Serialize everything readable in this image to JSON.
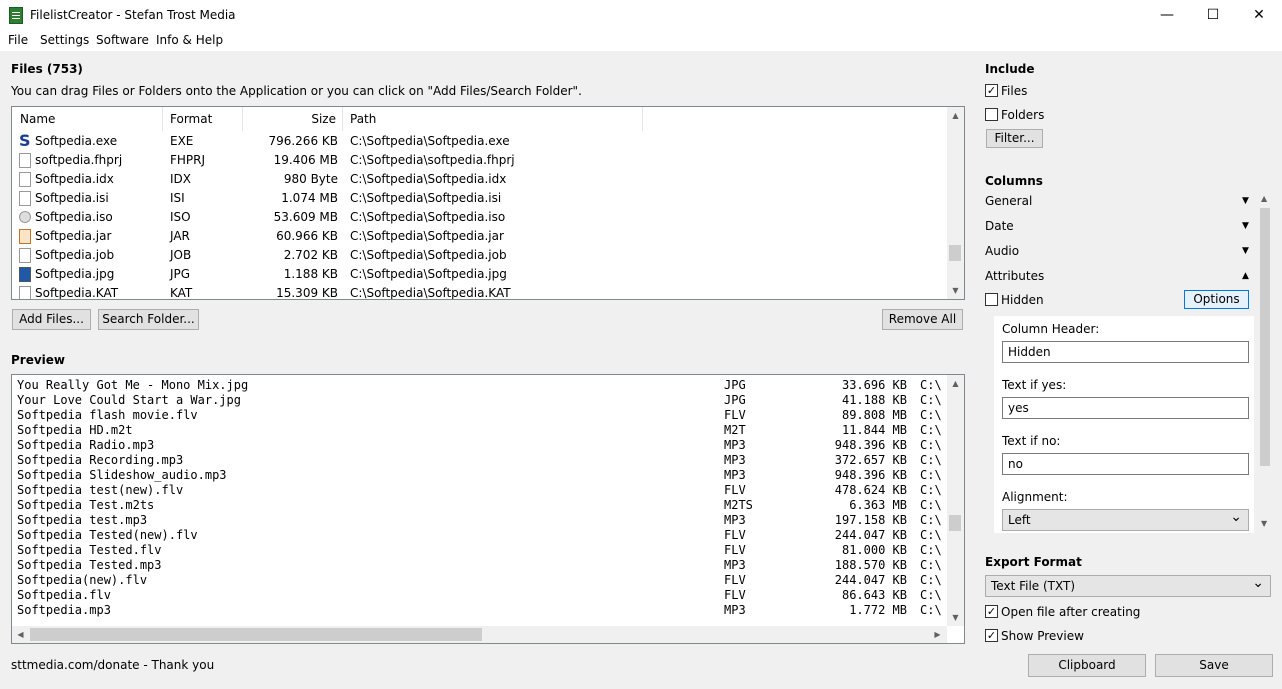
{
  "window": {
    "title": "FilelistCreator - Stefan Trost Media",
    "minimize_glyph": "—",
    "maximize_glyph": "☐",
    "close_glyph": "✕"
  },
  "menu": [
    "File",
    "Settings",
    "Software",
    "Info & Help"
  ],
  "files": {
    "heading": "Files (753)",
    "hint": "You can drag Files or Folders onto the Application or you can click on \"Add Files/Search Folder\".",
    "columns": [
      "Name",
      "Format",
      "Size",
      "Path"
    ],
    "rows": [
      {
        "name": "Softpedia.exe",
        "format": "EXE",
        "size": "796.266 KB",
        "path": "C:\\Softpedia\\Softpedia.exe",
        "icon": "softpedia-s-icon"
      },
      {
        "name": "softpedia.fhprj",
        "format": "FHPRJ",
        "size": "19.406 MB",
        "path": "C:\\Softpedia\\softpedia.fhprj",
        "icon": "file-icon"
      },
      {
        "name": "Softpedia.idx",
        "format": "IDX",
        "size": "980 Byte",
        "path": "C:\\Softpedia\\Softpedia.idx",
        "icon": "file-icon"
      },
      {
        "name": "Softpedia.isi",
        "format": "ISI",
        "size": "1.074 MB",
        "path": "C:\\Softpedia\\Softpedia.isi",
        "icon": "file-icon"
      },
      {
        "name": "Softpedia.iso",
        "format": "ISO",
        "size": "53.609 MB",
        "path": "C:\\Softpedia\\Softpedia.iso",
        "icon": "disc-icon"
      },
      {
        "name": "Softpedia.jar",
        "format": "JAR",
        "size": "60.966 KB",
        "path": "C:\\Softpedia\\Softpedia.jar",
        "icon": "java-icon"
      },
      {
        "name": "Softpedia.job",
        "format": "JOB",
        "size": "2.702 KB",
        "path": "C:\\Softpedia\\Softpedia.job",
        "icon": "file-icon"
      },
      {
        "name": "Softpedia.jpg",
        "format": "JPG",
        "size": "1.188 KB",
        "path": "C:\\Softpedia\\Softpedia.jpg",
        "icon": "image-icon"
      },
      {
        "name": "Softpedia.KAT",
        "format": "KAT",
        "size": "15.309 KB",
        "path": "C:\\Softpedia\\Softpedia.KAT",
        "icon": "file-icon"
      }
    ]
  },
  "buttons": {
    "add_files": "Add Files...",
    "search_folder": "Search Folder...",
    "remove_all": "Remove All",
    "filter": "Filter...",
    "options": "Options",
    "clipboard": "Clipboard",
    "save": "Save"
  },
  "preview": {
    "heading": "Preview",
    "rows": [
      {
        "name": "You Really Got Me - Mono Mix.jpg",
        "format": "JPG",
        "size": "33.696 KB",
        "path": "C:\\"
      },
      {
        "name": "Your Love Could Start a War.jpg",
        "format": "JPG",
        "size": "41.188 KB",
        "path": "C:\\"
      },
      {
        "name": "Softpedia flash movie.flv",
        "format": "FLV",
        "size": "89.808 MB",
        "path": "C:\\"
      },
      {
        "name": "Softpedia HD.m2t",
        "format": "M2T",
        "size": "11.844 MB",
        "path": "C:\\"
      },
      {
        "name": "Softpedia Radio.mp3",
        "format": "MP3",
        "size": "948.396 KB",
        "path": "C:\\"
      },
      {
        "name": "Softpedia Recording.mp3",
        "format": "MP3",
        "size": "372.657 KB",
        "path": "C:\\"
      },
      {
        "name": "Softpedia Slideshow_audio.mp3",
        "format": "MP3",
        "size": "948.396 KB",
        "path": "C:\\"
      },
      {
        "name": "Softpedia test(new).flv",
        "format": "FLV",
        "size": "478.624 KB",
        "path": "C:\\"
      },
      {
        "name": "Softpedia Test.m2ts",
        "format": "M2TS",
        "size": "6.363 MB",
        "path": "C:\\"
      },
      {
        "name": "Softpedia test.mp3",
        "format": "MP3",
        "size": "197.158 KB",
        "path": "C:\\"
      },
      {
        "name": "Softpedia Tested(new).flv",
        "format": "FLV",
        "size": "244.047 KB",
        "path": "C:\\"
      },
      {
        "name": "Softpedia Tested.flv",
        "format": "FLV",
        "size": "81.000 KB",
        "path": "C:\\"
      },
      {
        "name": "Softpedia Tested.mp3",
        "format": "MP3",
        "size": "188.570 KB",
        "path": "C:\\"
      },
      {
        "name": "Softpedia(new).flv",
        "format": "FLV",
        "size": "244.047 KB",
        "path": "C:\\"
      },
      {
        "name": "Softpedia.flv",
        "format": "FLV",
        "size": "86.643 KB",
        "path": "C:\\"
      },
      {
        "name": "Softpedia.mp3",
        "format": "MP3",
        "size": "1.772 MB",
        "path": "C:\\"
      }
    ]
  },
  "status": "sttmedia.com/donate - Thank you",
  "include": {
    "heading": "Include",
    "files_label": "Files",
    "files_checked": true,
    "folders_label": "Folders",
    "folders_checked": false
  },
  "columns_panel": {
    "heading": "Columns",
    "groups": [
      "General",
      "Date",
      "Audio",
      "Attributes"
    ],
    "hidden_label": "Hidden",
    "column_header_label": "Column Header:",
    "column_header_value": "Hidden",
    "text_if_yes_label": "Text if yes:",
    "text_if_yes_value": "yes",
    "text_if_no_label": "Text if no:",
    "text_if_no_value": "no",
    "alignment_label": "Alignment:",
    "alignment_value": "Left"
  },
  "export": {
    "heading": "Export Format",
    "format_value": "Text File (TXT)",
    "open_after_label": "Open file after creating",
    "open_after_checked": true,
    "show_preview_label": "Show Preview",
    "show_preview_checked": true
  },
  "glyphs": {
    "check": "✓",
    "tri_down": "▼",
    "tri_up": "▲",
    "chevron_down": "⌄",
    "scroll_up": "▲",
    "scroll_down": "▼",
    "scroll_left": "◀",
    "scroll_right": "▶"
  },
  "colors": {
    "accent": "#0078d7",
    "app_icon": "#2e7d32",
    "softpedia_blue": "#1a3d8f"
  }
}
